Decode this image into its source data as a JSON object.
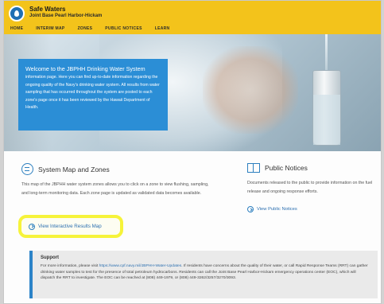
{
  "header": {
    "title": "Safe Waters",
    "subtitle": "Joint Base Pearl Harbor-Hickam",
    "nav": [
      "HOME",
      "INTERIM MAP",
      "ZONES",
      "PUBLIC NOTICES",
      "LEARN"
    ]
  },
  "hero": {
    "title": "Welcome to the JBPHH Drinking Water System",
    "text": "information page. Here you can find up-to-date information regarding the ongoing quality of the Navy's drinking water system. All results from water sampling that has occurred throughout the system are posted to each zone's page once it has been reviewed by the Hawaii Department of Health."
  },
  "map_section": {
    "title": "System Map and Zones",
    "text": "This map of the JBPHH water system zones allows you to click on a zone to view flushing, sampling, and long-term monitoring data. Each zone page is updated as validated data becomes available.",
    "link": "View Interactive Results Map"
  },
  "notices_section": {
    "title": "Public Notices",
    "text": "Documents released to the public to provide information on the fuel release and ongoing response efforts.",
    "link": "View Public Notices"
  },
  "support": {
    "title": "Support",
    "text_before": "For more information, please visit ",
    "url": "https://www.cpf.navy.mil/JBPHH-Water-Updates",
    "text_after": ". If residents have concerns about the quality of their water, or call Rapid Response Teams (RRT) can gather drinking water samples to test for the presence of total petroleum hydrocarbons. Residents can call the Joint Base Pearl Harbor-Hickam emergency operations center (EOC), which will dispatch the RRT to investigate. The EOC can be reached at (808) 449-1979, or (808) 449-3262/3257/3270/3093."
  },
  "colors": {
    "header": "#f3c31b",
    "accent": "#2b8ed6",
    "highlight": "#f6f33a"
  }
}
